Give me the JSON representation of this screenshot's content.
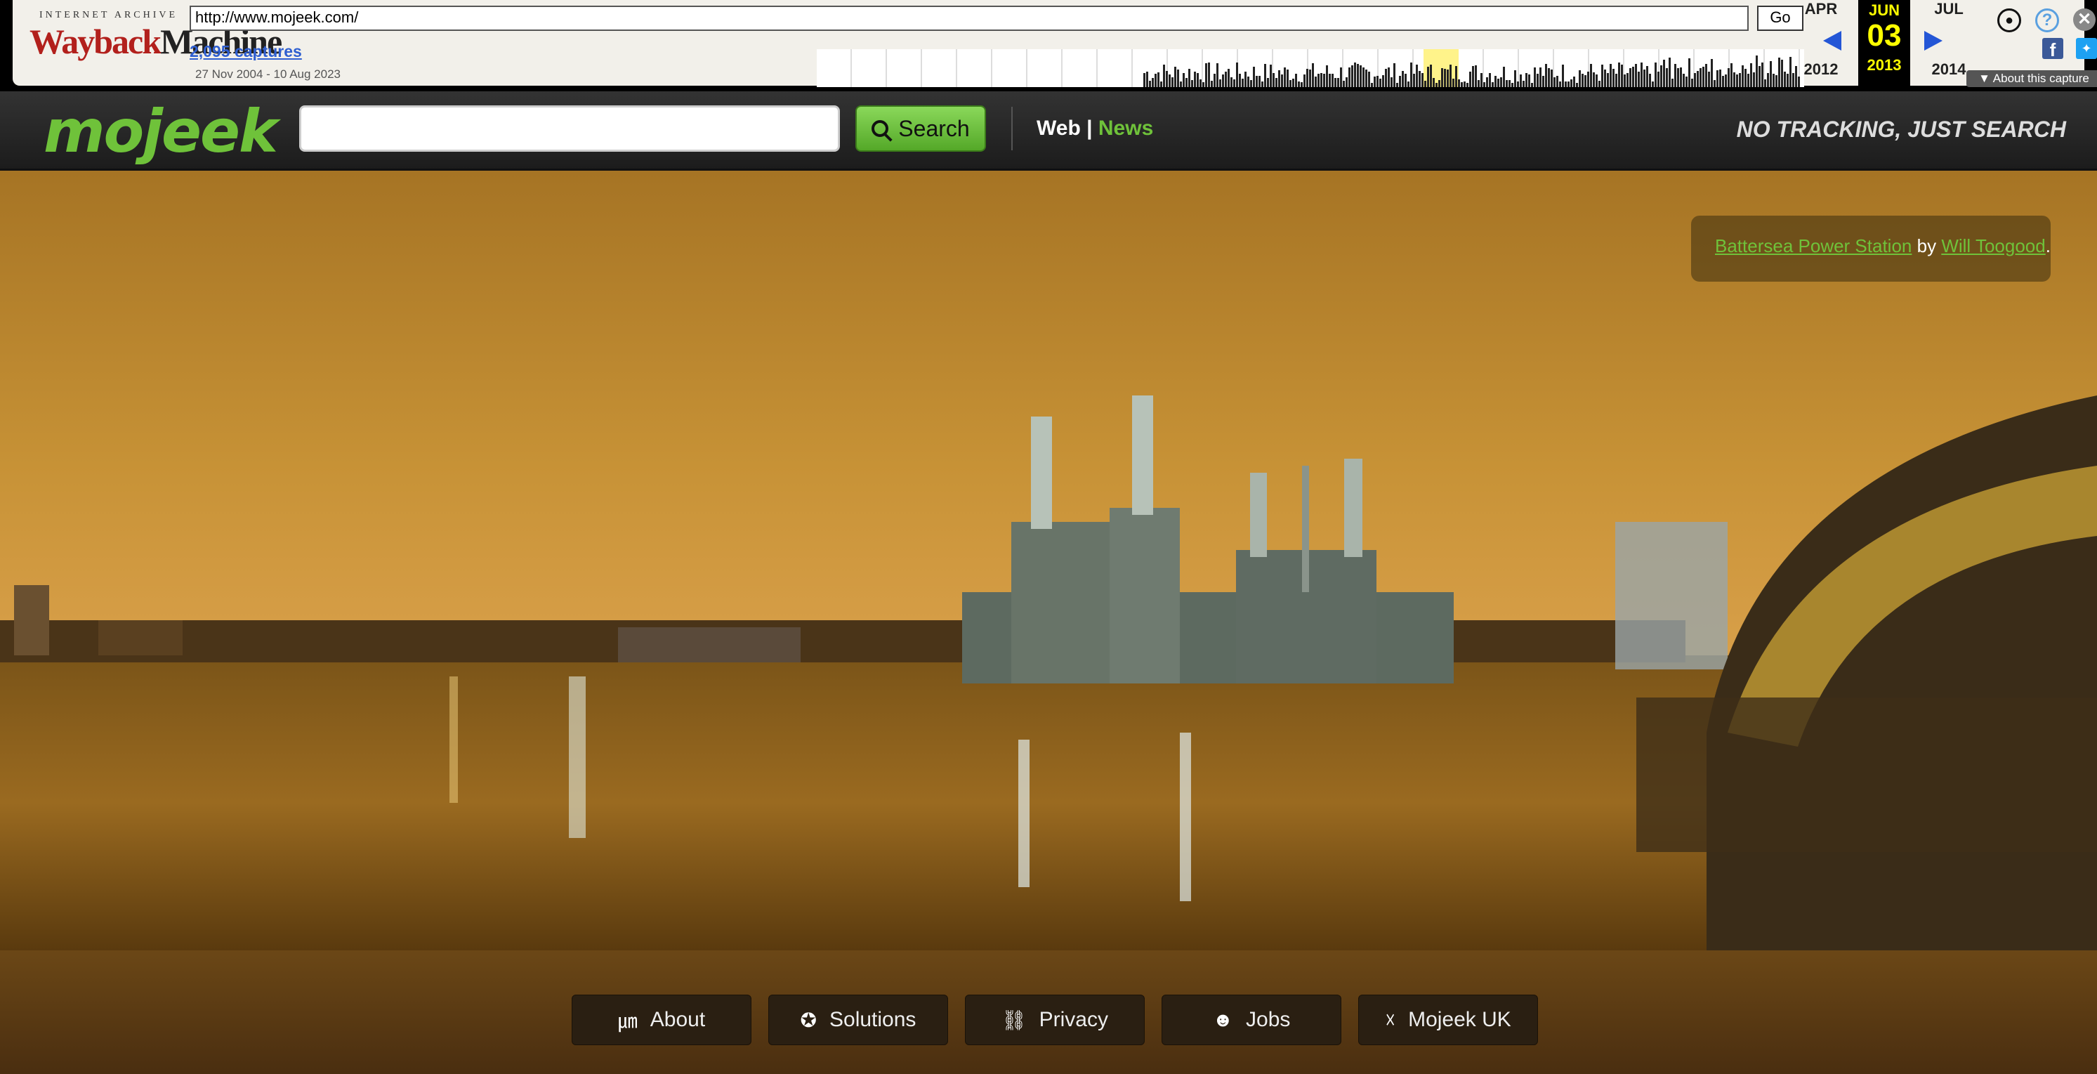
{
  "wayback": {
    "logo_top": "INTERNET ARCHIVE",
    "logo_wayback": "Wayback",
    "logo_machine": "Machine",
    "url": "http://www.mojeek.com/",
    "go_label": "Go",
    "captures": "2,095 captures",
    "date_range": "27 Nov 2004 - 10 Aug 2023",
    "prev_month": "APR",
    "prev_year": "2012",
    "cur_month": "JUN",
    "cur_day": "03",
    "cur_year": "2013",
    "next_month": "JUL",
    "next_year": "2014",
    "about_label": "About this capture"
  },
  "header": {
    "logo": "mojeek",
    "search_placeholder": "",
    "search_button": "Search",
    "nav_web": "Web",
    "nav_sep": "|",
    "nav_news": "News",
    "tagline": "NO TRACKING, JUST SEARCH"
  },
  "hero": {
    "credit_title": "Battersea Power Station",
    "credit_by": "by",
    "credit_author": "Will Toogood",
    "credit_end": "."
  },
  "footer": {
    "buttons": [
      {
        "label": "About",
        "icon": "mojeek-m-icon"
      },
      {
        "label": "Solutions",
        "icon": "puzzle-icon"
      },
      {
        "label": "Privacy",
        "icon": "lock-icon"
      },
      {
        "label": "Jobs",
        "icon": "person-icon"
      },
      {
        "label": "Mojeek UK",
        "icon": "uk-flag-icon"
      }
    ]
  },
  "colors": {
    "brand_green": "#6fc23a",
    "header_bg": "#2a2a2a",
    "wayback_highlight": "#fff38a"
  }
}
